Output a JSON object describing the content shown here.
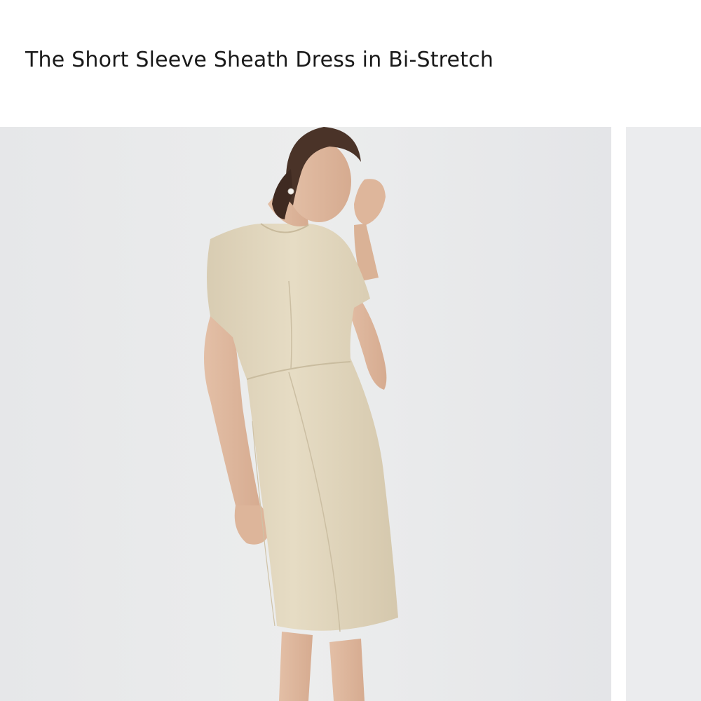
{
  "product": {
    "title": "The Short Sleeve Sheath Dress in Bi-Stretch"
  },
  "gallery": {
    "images": [
      {
        "icon": "model-wearing-dress-photo"
      },
      {
        "icon": "next-product-photo-partial"
      }
    ]
  },
  "colors": {
    "background": "#ffffff",
    "photo_background": "#e9eaec",
    "dress": "#e3d8c0",
    "title_text": "#1a1a1a"
  }
}
